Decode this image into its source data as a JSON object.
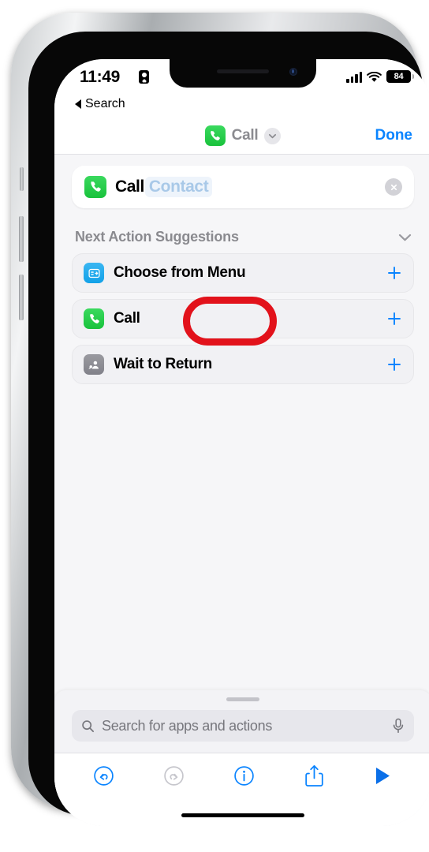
{
  "status_bar": {
    "time": "11:49",
    "focus_icon": "focus-badge-icon",
    "signal_icon": "cellular-signal-icon",
    "wifi_icon": "wifi-icon",
    "battery_level": "84"
  },
  "back_nav": {
    "label": "Search",
    "icon": "back-caret-icon"
  },
  "nav_bar": {
    "app_icon": "phone-app-icon",
    "title": "Call",
    "chevron_icon": "chevron-down-icon",
    "done_label": "Done"
  },
  "action": {
    "icon": "phone-app-icon",
    "label": "Call",
    "token": "Contact",
    "clear_icon": "clear-circle-icon"
  },
  "annotation": {
    "shape": "red-oval-highlight",
    "color": "#e2121b",
    "targets": "Contact"
  },
  "suggestions_section": {
    "title": "Next Action Suggestions",
    "collapse_icon": "chevron-down-icon",
    "items": [
      {
        "label": "Choose from Menu",
        "icon": "menu-list-icon",
        "color": "blue",
        "add_icon": "plus-icon"
      },
      {
        "label": "Call",
        "icon": "phone-icon",
        "color": "green",
        "add_icon": "plus-icon"
      },
      {
        "label": "Wait to Return",
        "icon": "person-wait-icon",
        "color": "gray",
        "add_icon": "plus-icon"
      }
    ]
  },
  "sheet": {
    "grabber": "sheet-grabber",
    "search": {
      "placeholder": "Search for apps and actions",
      "search_icon": "search-icon",
      "mic_icon": "microphone-icon"
    },
    "toolbar": [
      {
        "name": "undo-button",
        "icon": "undo-icon",
        "enabled": "true"
      },
      {
        "name": "redo-button",
        "icon": "redo-icon",
        "enabled": "false"
      },
      {
        "name": "info-button",
        "icon": "info-icon",
        "enabled": "true"
      },
      {
        "name": "share-button",
        "icon": "share-icon",
        "enabled": "true"
      },
      {
        "name": "run-button",
        "icon": "play-icon",
        "enabled": "true"
      }
    ]
  },
  "colors": {
    "accent_blue": "#0a84ff",
    "green": "#19c23c",
    "annotation_red": "#e2121b",
    "token_blue": "#a9c9e8",
    "background": "#f6f6f8"
  }
}
